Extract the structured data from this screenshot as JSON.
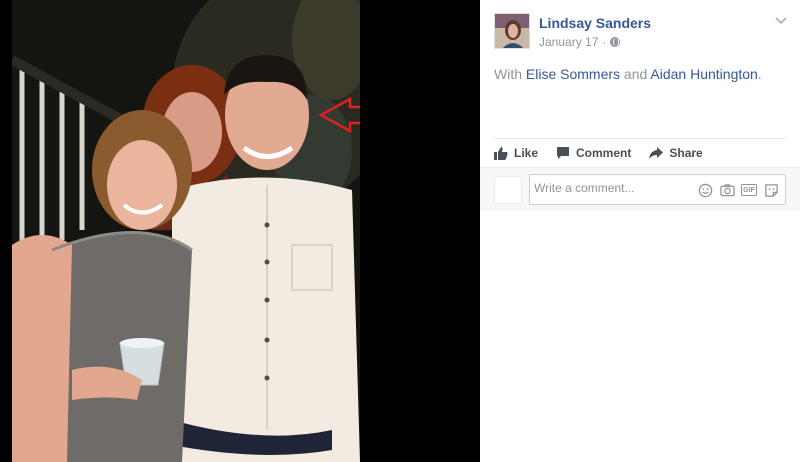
{
  "post": {
    "author": "Lindsay Sanders",
    "date": "January 17",
    "separator": "·",
    "privacy_icon": "globe-icon",
    "with_prefix": "With",
    "tagged": [
      "Elise Sommers",
      "Aidan Huntington"
    ],
    "with_joiner": "and",
    "with_suffix": "."
  },
  "actions": {
    "like_label": "Like",
    "comment_label": "Comment",
    "share_label": "Share"
  },
  "comment": {
    "placeholder": "Write a comment...",
    "tools": [
      "smiley-icon",
      "camera-icon",
      "gif-icon",
      "sticker-icon"
    ],
    "gif_label": "GIF"
  },
  "colors": {
    "link": "#365899",
    "meta": "#90949c",
    "annotation_arrow": "#e02020"
  }
}
